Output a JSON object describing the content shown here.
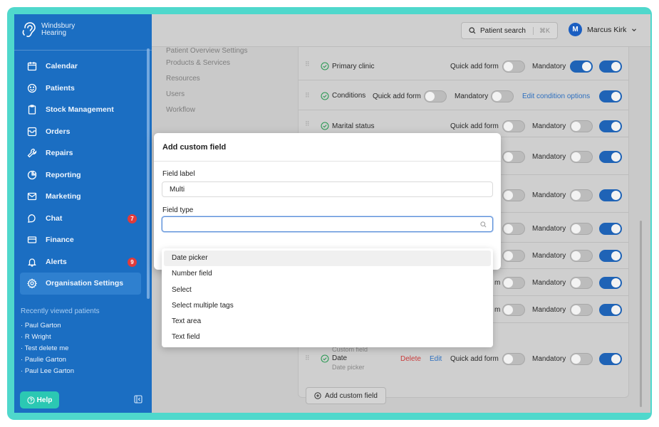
{
  "brand": {
    "name_line1": "Windsbury",
    "name_line2": "Hearing"
  },
  "sidebar": {
    "items": [
      {
        "label": "Calendar",
        "icon": "calendar-icon"
      },
      {
        "label": "Patients",
        "icon": "smile-icon"
      },
      {
        "label": "Stock Management",
        "icon": "clipboard-icon"
      },
      {
        "label": "Orders",
        "icon": "inbox-icon"
      },
      {
        "label": "Repairs",
        "icon": "wrench-icon"
      },
      {
        "label": "Reporting",
        "icon": "pie-chart-icon"
      },
      {
        "label": "Marketing",
        "icon": "mail-icon"
      },
      {
        "label": "Chat",
        "icon": "chat-icon",
        "badge": "7"
      },
      {
        "label": "Finance",
        "icon": "card-icon"
      },
      {
        "label": "Alerts",
        "icon": "bell-icon",
        "badge": "9"
      },
      {
        "label": "Organisation Settings",
        "icon": "gear-icon",
        "active": true
      }
    ],
    "recent_title": "Recently viewed patients",
    "recent": [
      "Paul Garton",
      "R Wright",
      "Test delete me",
      "Paulie Garton",
      "Paul Lee Garton"
    ],
    "help_label": "Help"
  },
  "header": {
    "search_label": "Patient search",
    "search_shortcut": "⌘K",
    "user_initial": "M",
    "user_name": "Marcus Kirk"
  },
  "settings_menu": [
    "Patient Overview Settings",
    "Products & Services",
    "Resources",
    "Users",
    "Workflow"
  ],
  "fields": {
    "primary_clinic": "Primary clinic",
    "conditions": "Conditions",
    "marital_status": "Marital status",
    "custom_field_caption": "Custom field",
    "date": "Date",
    "date_type": "Date picker",
    "quick_add_form": "Quick add form",
    "quick_add_form_partial": "m",
    "mandatory": "Mandatory",
    "edit_condition_options": "Edit condition options",
    "delete": "Delete",
    "edit": "Edit",
    "add_custom_field": "Add custom field"
  },
  "modal": {
    "title": "Add custom field",
    "field_label_caption": "Field label",
    "field_label_value": "Multi",
    "field_type_caption": "Field type",
    "field_type_value": ""
  },
  "field_type_options": [
    "Date picker",
    "Number field",
    "Select",
    "Select multiple tags",
    "Text area",
    "Text field"
  ],
  "colors": {
    "sidebar": "#1b6ec2",
    "accent": "#1f63b6",
    "help": "#2bc8b3",
    "badge": "#e03b3b",
    "frame": "#4fd8cc"
  }
}
